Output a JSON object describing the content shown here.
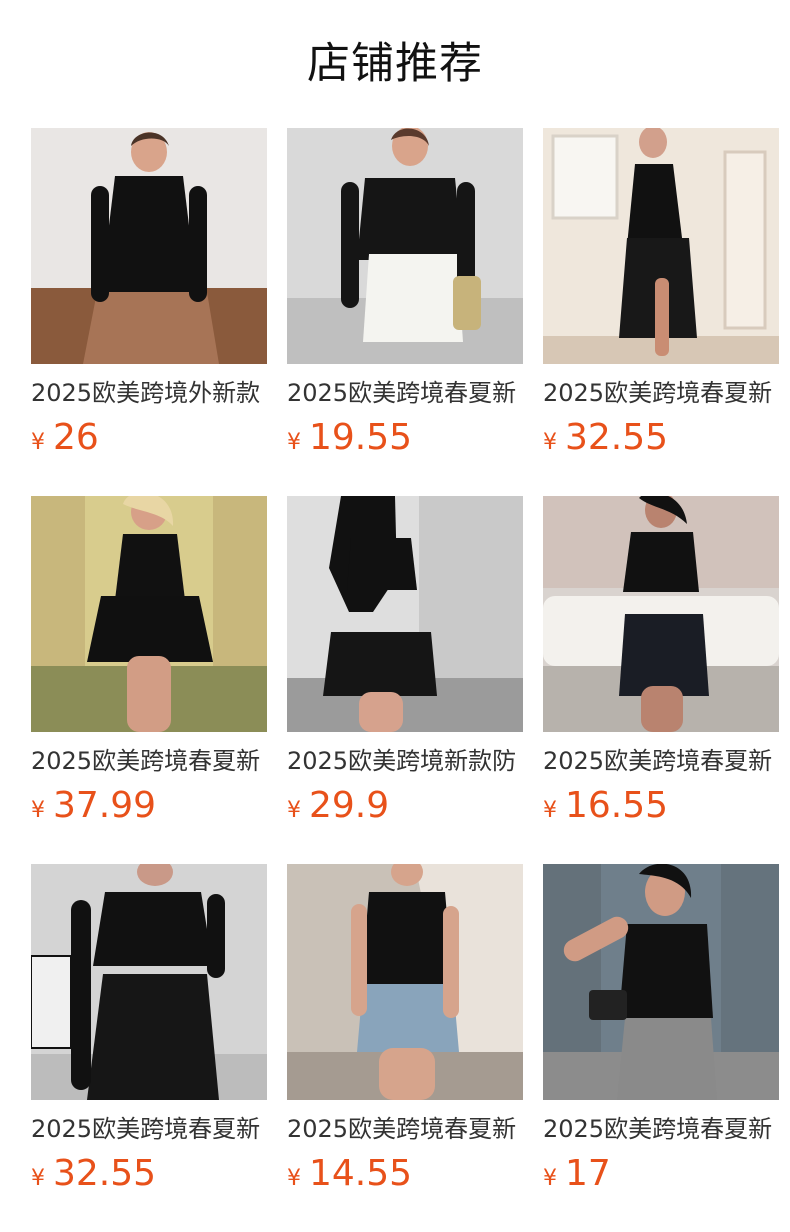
{
  "section": {
    "title": "店铺推荐"
  },
  "currency_symbol": "¥",
  "theme": {
    "price_color": "#e8511a",
    "title_color": "#333333"
  },
  "products": [
    {
      "title": "2025欧美跨境外新款",
      "price": "26",
      "photo": "black-long-sleeve-top-leather-skirt",
      "bg": "#e9e6e4",
      "floor": "#8a5a3c",
      "outfit_top": "#111111",
      "outfit_bottom": "#a77456"
    },
    {
      "title": "2025欧美跨境春夏新",
      "price": "19.55",
      "photo": "black-top-white-mini-skirt",
      "bg": "#d9d9d9",
      "floor": "#bfbfbf",
      "outfit_top": "#151515",
      "outfit_bottom": "#f4f4f0"
    },
    {
      "title": "2025欧美跨境春夏新",
      "price": "32.55",
      "photo": "black-halter-slit-dress",
      "bg": "#efe7dc",
      "floor": "#d7c7b5",
      "outfit_top": "#111111",
      "outfit_bottom": "#181818"
    },
    {
      "title": "2025欧美跨境春夏新",
      "price": "37.99",
      "photo": "black-mini-dress-hallway",
      "bg": "#d8cc8d",
      "floor": "#8b8d57",
      "outfit_top": "#111111",
      "outfit_bottom": "#101010"
    },
    {
      "title": "2025欧美跨境新款防",
      "price": "29.9",
      "photo": "black-crop-top-mini-skirt",
      "bg": "#dedede",
      "floor": "#9b9b9b",
      "outfit_top": "#111111",
      "outfit_bottom": "#151515"
    },
    {
      "title": "2025欧美跨境春夏新",
      "price": "16.55",
      "photo": "black-cutout-bodysuit-skirt",
      "bg": "#d9d3cf",
      "floor": "#b7b2ac",
      "outfit_top": "#111111",
      "outfit_bottom": "#1a1d25"
    },
    {
      "title": "2025欧美跨境春夏新",
      "price": "32.55",
      "photo": "black-cutout-top-black-pants",
      "bg": "#d4d4d4",
      "floor": "#bcbcbc",
      "outfit_top": "#111111",
      "outfit_bottom": "#161616"
    },
    {
      "title": "2025欧美跨境春夏新",
      "price": "14.55",
      "photo": "black-bodysuit-denim-shorts",
      "bg": "#c9c1b7",
      "floor": "#a59b91",
      "outfit_top": "#111111",
      "outfit_bottom": "#89a4bb"
    },
    {
      "title": "2025欧美跨境春夏新",
      "price": "17",
      "photo": "black-halter-cutout-top-gray-pants",
      "bg": "#6f7f8b",
      "floor": "#8c8c8c",
      "outfit_top": "#111111",
      "outfit_bottom": "#8a8a8a"
    }
  ]
}
